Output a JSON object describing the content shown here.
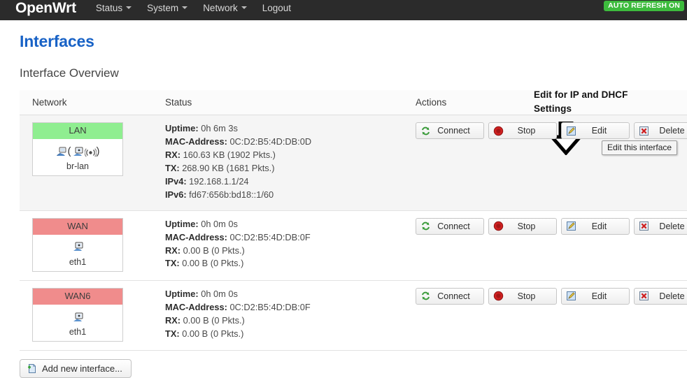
{
  "navbar": {
    "brand": "OpenWrt",
    "items": [
      {
        "label": "Status",
        "has_caret": true
      },
      {
        "label": "System",
        "has_caret": true
      },
      {
        "label": "Network",
        "has_caret": true
      },
      {
        "label": "Logout",
        "has_caret": false
      }
    ],
    "auto_refresh_badge": "AUTO REFRESH ON",
    "badge_color": "#3dbb3d"
  },
  "page": {
    "title": "Interfaces",
    "title_color": "#1862c6",
    "section_title": "Interface Overview"
  },
  "annotation": {
    "line1": "Edit for IP and DHCF",
    "line2": "Settings"
  },
  "table": {
    "headers": {
      "network": "Network",
      "status": "Status",
      "actions": "Actions"
    },
    "rows": [
      {
        "name": "LAN",
        "state": "up",
        "badge_color": "#8fee90",
        "device": "br-lan",
        "bridge": true,
        "icons": [
          "bridge-icon",
          "ethernet-icon",
          "wifi-icon"
        ],
        "status": [
          {
            "label": "Uptime:",
            "value": "0h 6m 3s"
          },
          {
            "label": "MAC-Address:",
            "value": "0C:D2:B5:4D:DB:0D"
          },
          {
            "label": "RX:",
            "value": "160.63 KB (1902 Pkts.)"
          },
          {
            "label": "TX:",
            "value": "268.90 KB (1681 Pkts.)"
          },
          {
            "label": "IPv4:",
            "value": "192.168.1.1/24"
          },
          {
            "label": "IPv6:",
            "value": "fd67:656b:bd18::1/60"
          }
        ],
        "actions": [
          "Connect",
          "Stop",
          "Edit",
          "Delete"
        ],
        "tooltip": "Edit this interface"
      },
      {
        "name": "WAN",
        "state": "down",
        "badge_color": "#f08c8c",
        "device": "eth1",
        "bridge": false,
        "icons": [
          "ethernet-icon"
        ],
        "status": [
          {
            "label": "Uptime:",
            "value": "0h 0m 0s"
          },
          {
            "label": "MAC-Address:",
            "value": "0C:D2:B5:4D:DB:0F"
          },
          {
            "label": "RX:",
            "value": "0.00 B (0 Pkts.)"
          },
          {
            "label": "TX:",
            "value": "0.00 B (0 Pkts.)"
          }
        ],
        "actions": [
          "Connect",
          "Stop",
          "Edit",
          "Delete"
        ],
        "tooltip": ""
      },
      {
        "name": "WAN6",
        "state": "down",
        "badge_color": "#f08c8c",
        "device": "eth1",
        "bridge": false,
        "icons": [
          "ethernet-icon"
        ],
        "status": [
          {
            "label": "Uptime:",
            "value": "0h 0m 0s"
          },
          {
            "label": "MAC-Address:",
            "value": "0C:D2:B5:4D:DB:0F"
          },
          {
            "label": "RX:",
            "value": "0.00 B (0 Pkts.)"
          },
          {
            "label": "TX:",
            "value": "0.00 B (0 Pkts.)"
          }
        ],
        "actions": [
          "Connect",
          "Stop",
          "Edit",
          "Delete"
        ],
        "tooltip": ""
      }
    ]
  },
  "footer": {
    "add_button": "Add new interface..."
  }
}
